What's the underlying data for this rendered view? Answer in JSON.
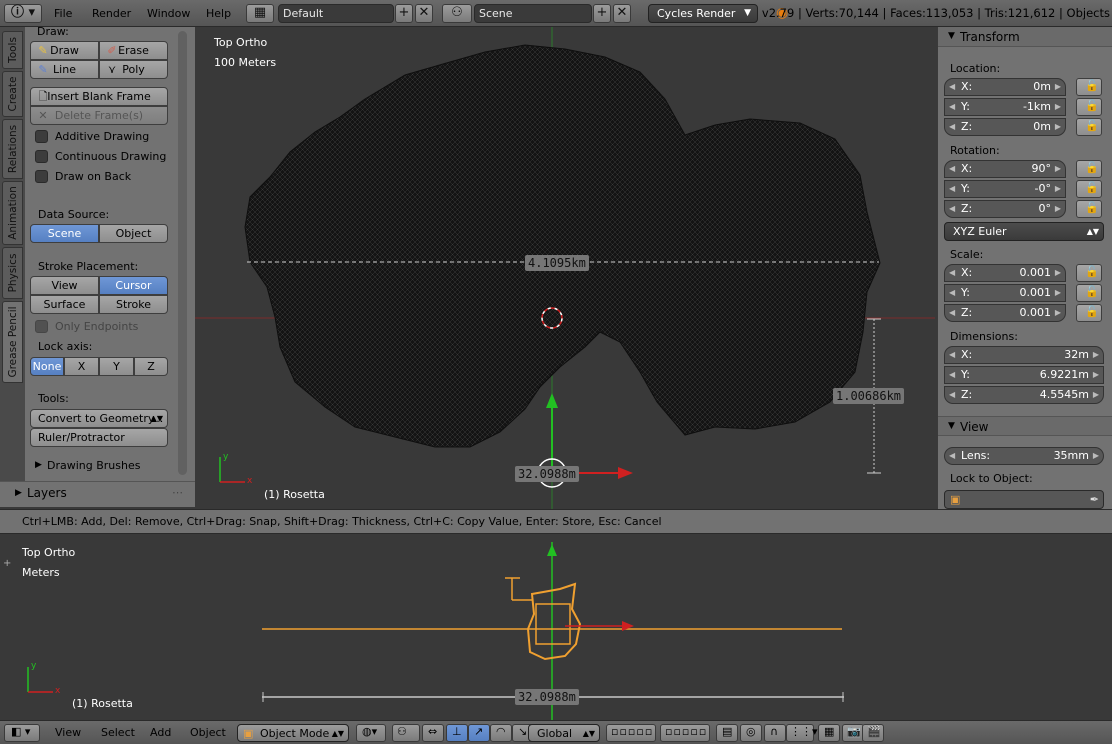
{
  "top_bar": {
    "menus": [
      "File",
      "Render",
      "Window",
      "Help"
    ],
    "layout": "Default",
    "scene": "Scene",
    "render_engine": "Cycles Render",
    "stats": "v2.79 | Verts:70,144 | Faces:113,053 | Tris:121,612 | Objects"
  },
  "tabs": [
    "Tools",
    "Create",
    "Relations",
    "Animation",
    "Physics",
    "Grease Pencil"
  ],
  "shelf": {
    "draw_label": "Draw:",
    "draw": "Draw",
    "erase": "Erase",
    "line": "Line",
    "poly": "Poly",
    "insert_blank_frame": "Insert Blank Frame",
    "delete_frames": "Delete Frame(s)",
    "additive_drawing": "Additive Drawing",
    "continuous_drawing": "Continuous Drawing",
    "draw_on_back": "Draw on Back",
    "data_source_label": "Data Source:",
    "data_source_scene": "Scene",
    "data_source_object": "Object",
    "stroke_placement_label": "Stroke Placement:",
    "placement_view": "View",
    "placement_cursor": "Cursor",
    "placement_surface": "Surface",
    "placement_stroke": "Stroke",
    "only_endpoints": "Only Endpoints",
    "lock_axis_label": "Lock axis:",
    "lock_none": "None",
    "lock_x": "X",
    "lock_y": "Y",
    "lock_z": "Z",
    "tools_label": "Tools:",
    "convert_to_geometry": "Convert to Geometry...",
    "ruler_protractor": "Ruler/Protractor",
    "drawing_brushes": "Drawing Brushes",
    "layers": "Layers"
  },
  "viewport_top": {
    "view_name": "Top Ortho",
    "scale": "100 Meters",
    "object_name": "(1) Rosetta",
    "measure_width": "4.1095km",
    "measure_height": "1.00686km",
    "measure_origin": "32.0988m"
  },
  "status_bar": "Ctrl+LMB: Add, Del: Remove, Ctrl+Drag: Snap, Shift+Drag: Thickness, Ctrl+C: Copy Value, Enter: Store,  Esc: Cancel",
  "viewport_bottom": {
    "view_name": "Top Ortho",
    "scale": "Meters",
    "object_name": "(1) Rosetta",
    "measure": "32.0988m"
  },
  "properties": {
    "transform_title": "Transform",
    "location_label": "Location:",
    "location": [
      {
        "axis": "X:",
        "value": "0m"
      },
      {
        "axis": "Y:",
        "value": "-1km"
      },
      {
        "axis": "Z:",
        "value": "0m"
      }
    ],
    "rotation_label": "Rotation:",
    "rotation": [
      {
        "axis": "X:",
        "value": "90°"
      },
      {
        "axis": "Y:",
        "value": "-0°"
      },
      {
        "axis": "Z:",
        "value": "0°"
      }
    ],
    "rotation_mode": "XYZ Euler",
    "scale_label": "Scale:",
    "scale": [
      {
        "axis": "X:",
        "value": "0.001"
      },
      {
        "axis": "Y:",
        "value": "0.001"
      },
      {
        "axis": "Z:",
        "value": "0.001"
      }
    ],
    "dimensions_label": "Dimensions:",
    "dimensions": [
      {
        "axis": "X:",
        "value": "32m"
      },
      {
        "axis": "Y:",
        "value": "6.9221m"
      },
      {
        "axis": "Z:",
        "value": "4.5545m"
      }
    ],
    "view_title": "View",
    "lens_label": "Lens:",
    "lens_value": "35mm",
    "lock_to_object_label": "Lock to Object:"
  },
  "bottom_bar": {
    "view": "View",
    "select": "Select",
    "add": "Add",
    "object": "Object",
    "mode": "Object Mode",
    "orientation": "Global"
  },
  "colors": {
    "accent_blue": "#5680c2",
    "selected_orange": "#f0a030",
    "axis_green": "#22c022",
    "axis_red": "#d02020"
  }
}
